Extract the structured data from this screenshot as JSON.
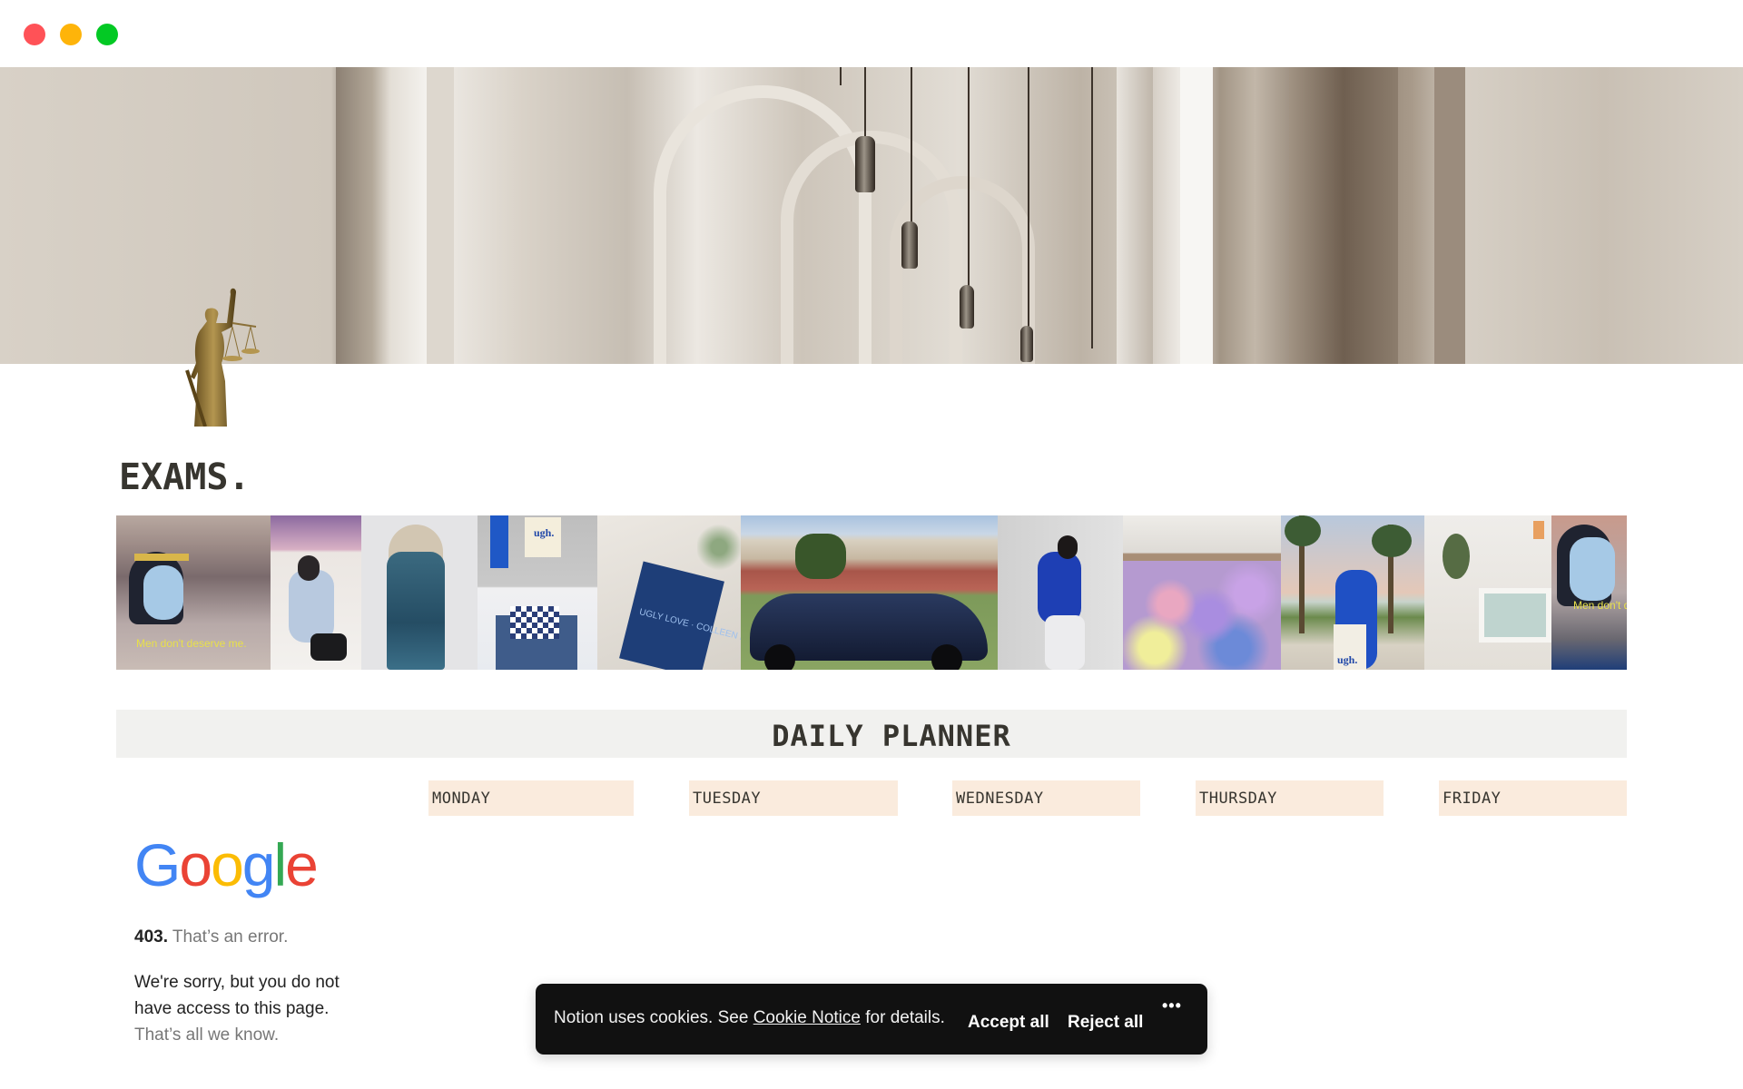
{
  "window": {
    "controls": [
      "close",
      "minimize",
      "maximize"
    ]
  },
  "cover": {
    "description": "courthouse colonnade with hanging lanterns"
  },
  "page": {
    "icon": "lady-justice-statue",
    "title": "EXAMS."
  },
  "mood_board": {
    "tiles": [
      {
        "subject": "cartoon queen",
        "caption": "Men don't deserve me."
      },
      {
        "subject": "mirror selfie in blue shirt",
        "caption": ""
      },
      {
        "subject": "blue sequin dress",
        "caption": ""
      },
      {
        "subject": "tote bag and checkered bed",
        "caption": "ugh."
      },
      {
        "subject": "Ugly Love book",
        "caption": "UGLY LOVE · COLLEEN HOOVER"
      },
      {
        "subject": "navy sports car",
        "caption": ""
      },
      {
        "subject": "person in blue sweater",
        "caption": ""
      },
      {
        "subject": "pastel flower bouquet",
        "caption": ""
      },
      {
        "subject": "palm trees and tote bag",
        "caption": "ugh."
      },
      {
        "subject": "bathroom with tub",
        "caption": ""
      },
      {
        "subject": "cartoon queen repeat",
        "caption": "Men don't d"
      }
    ]
  },
  "planner": {
    "title": "DAILY PLANNER",
    "days": [
      "MONDAY",
      "TUESDAY",
      "WEDNESDAY",
      "THURSDAY",
      "FRIDAY"
    ]
  },
  "embed": {
    "logo": "Google",
    "error_code": "403.",
    "error_title": "That’s an error.",
    "message": "We're sorry, but you do not have access to this page.",
    "footer": "That’s all we know."
  },
  "cookie_banner": {
    "text_before": "Notion uses cookies. See ",
    "link": "Cookie Notice",
    "text_after": " for details.",
    "accept_label": "Accept all",
    "reject_label": "Reject all",
    "more_label": "•••"
  },
  "colors": {
    "text": "#37352f",
    "planner_bar": "#f1f1ef",
    "day_header": "#faebdd",
    "cookie_bg": "#111111"
  }
}
